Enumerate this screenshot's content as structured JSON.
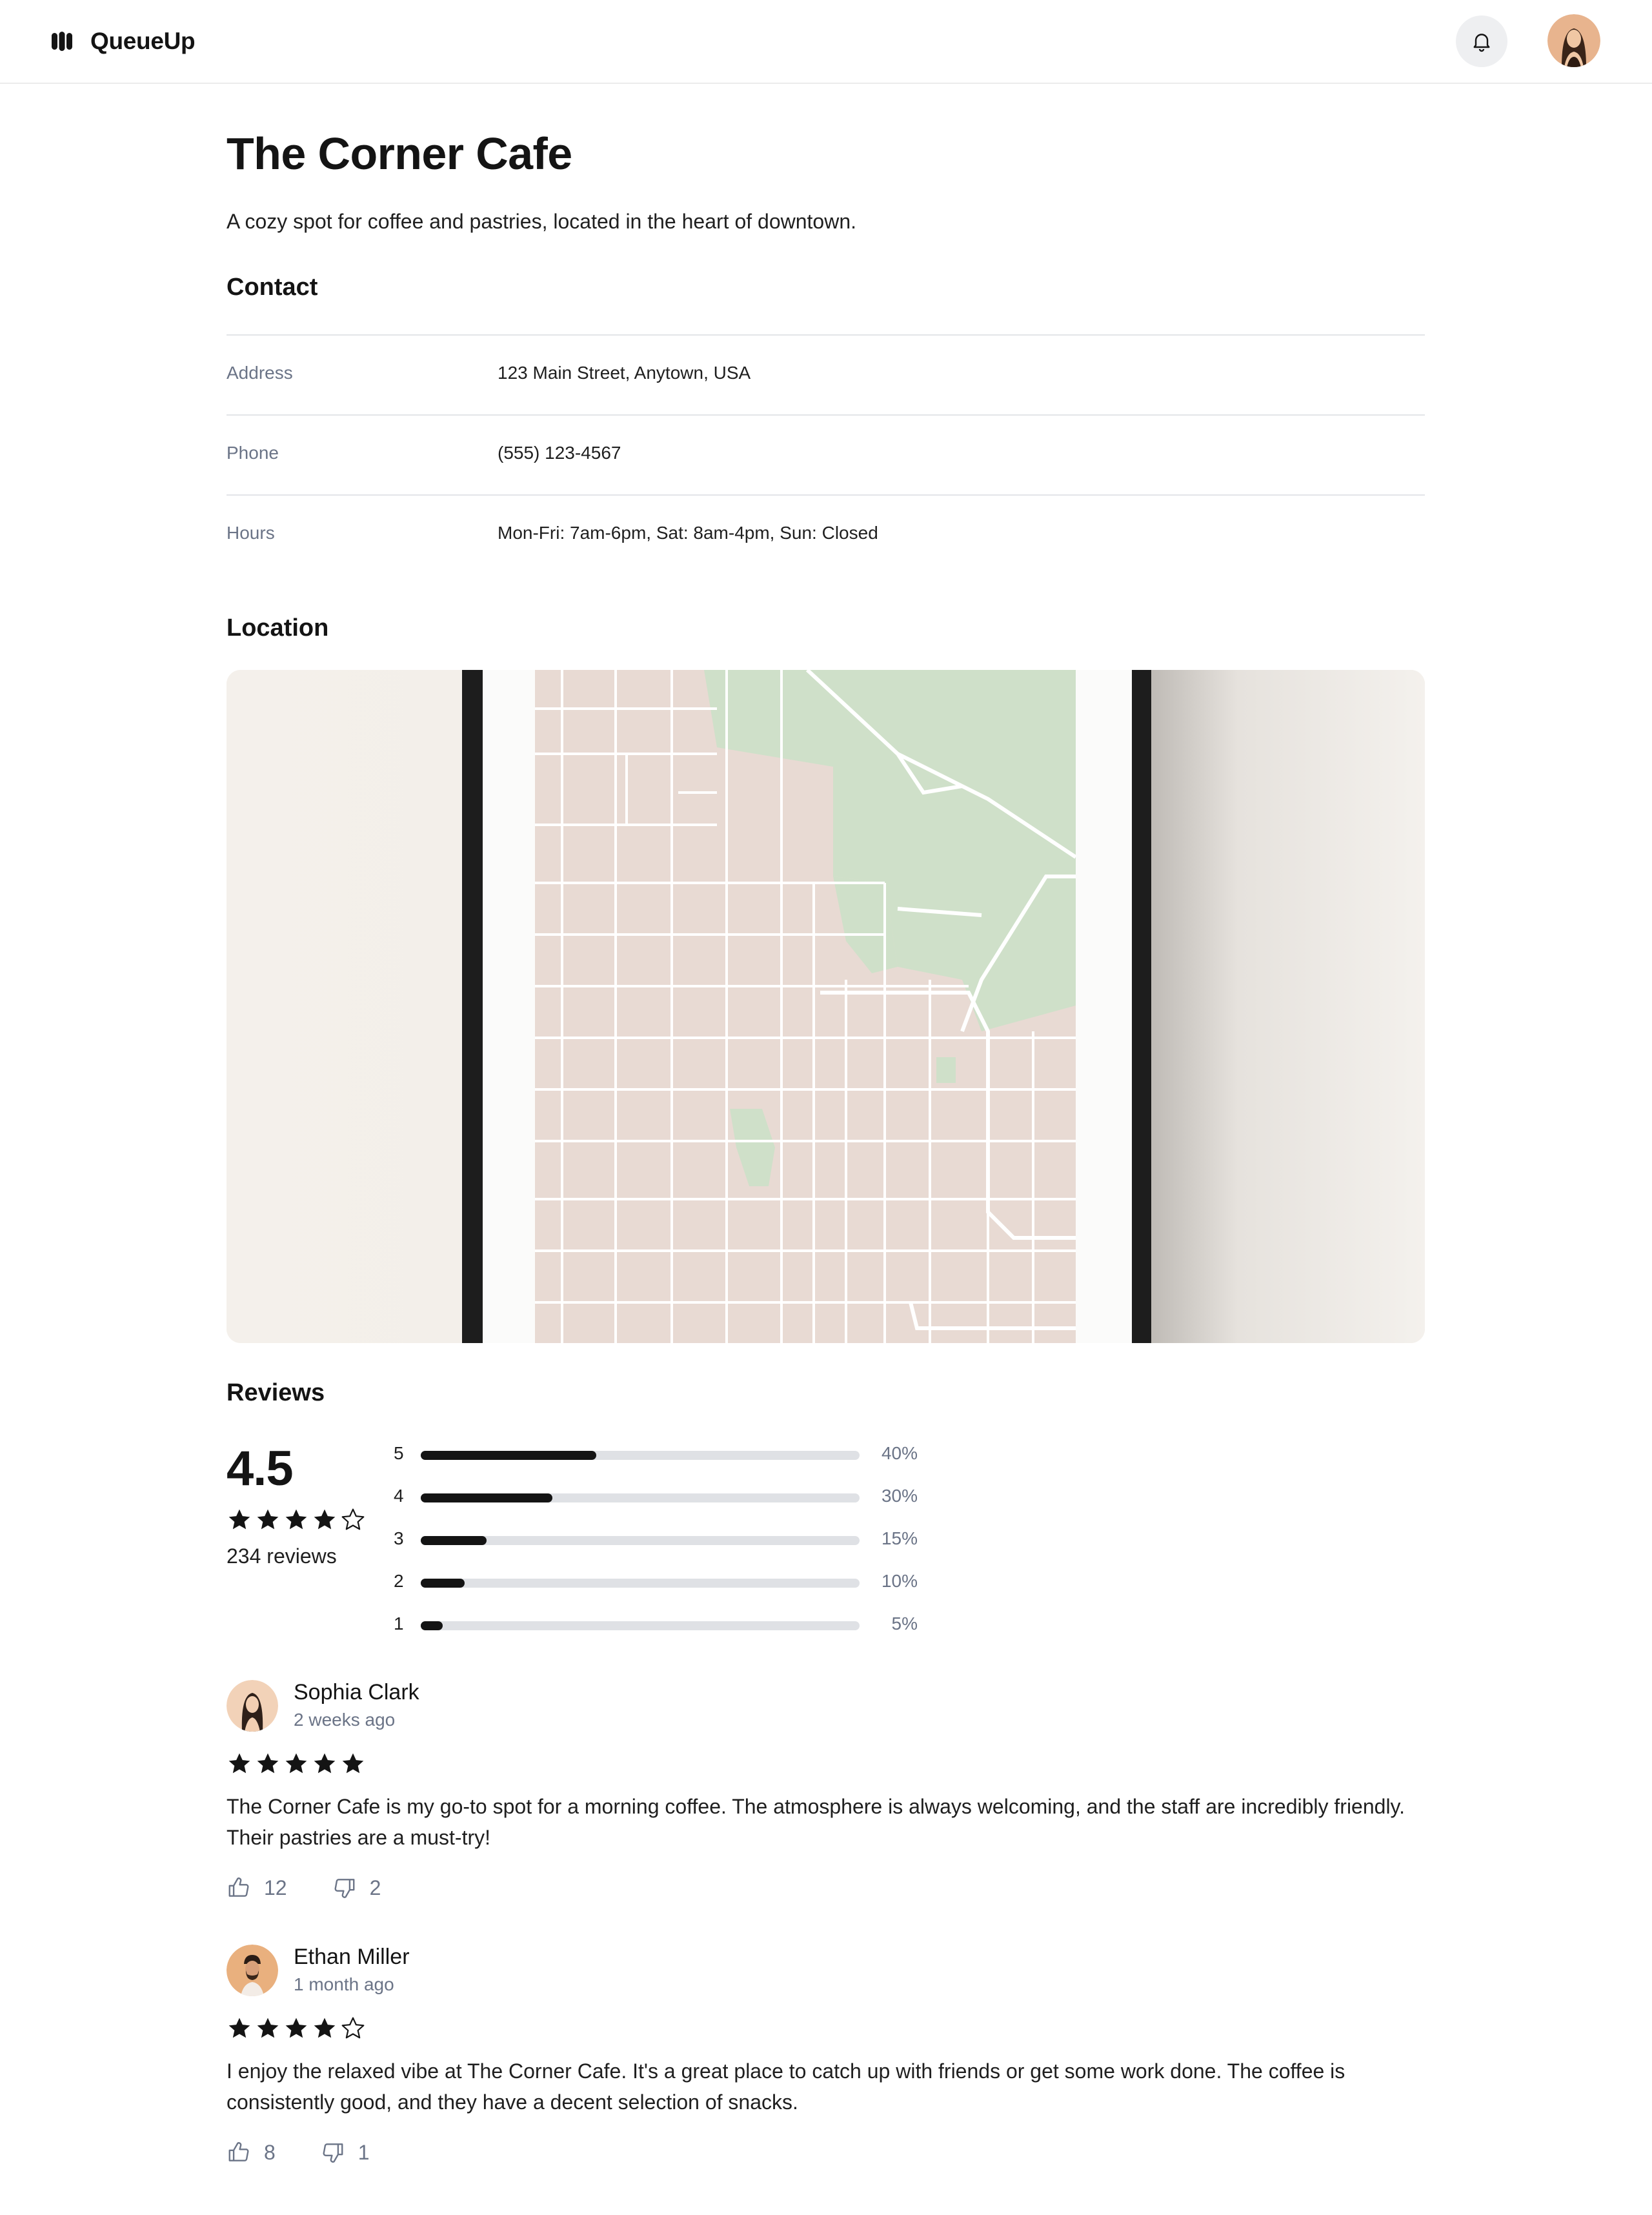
{
  "header": {
    "app_name": "QueueUp",
    "logo_icon": "queueup-logo-icon",
    "notification_icon": "bell-icon",
    "avatar": "user-avatar"
  },
  "place": {
    "name": "The Corner Cafe",
    "description": "A cozy spot for coffee and pastries, located in the heart of downtown."
  },
  "contact": {
    "heading": "Contact",
    "rows": [
      {
        "label": "Address",
        "value": "123 Main Street, Anytown, USA"
      },
      {
        "label": "Phone",
        "value": "(555) 123-4567"
      },
      {
        "label": "Hours",
        "value": "Mon-Fri: 7am-6pm, Sat: 8am-4pm, Sun: Closed"
      }
    ]
  },
  "location": {
    "heading": "Location",
    "map": "framed-street-map-image"
  },
  "reviews": {
    "heading": "Reviews",
    "average": "4.5",
    "average_stars": 4,
    "count_label": "234 reviews",
    "distribution": [
      {
        "stars": "5",
        "percent": 40,
        "label": "40%"
      },
      {
        "stars": "4",
        "percent": 30,
        "label": "30%"
      },
      {
        "stars": "3",
        "percent": 15,
        "label": "15%"
      },
      {
        "stars": "2",
        "percent": 10,
        "label": "10%"
      },
      {
        "stars": "1",
        "percent": 5,
        "label": "5%"
      }
    ],
    "items": [
      {
        "name": "Sophia Clark",
        "date": "2 weeks ago",
        "stars": 5,
        "text": "The Corner Cafe is my go-to spot for a morning coffee. The atmosphere is always welcoming, and the staff are incredibly friendly. Their pastries are a must-try!",
        "likes": "12",
        "dislikes": "2"
      },
      {
        "name": "Ethan Miller",
        "date": "1 month ago",
        "stars": 4,
        "text": "I enjoy the relaxed vibe at The Corner Cafe. It's a great place to catch up with friends or get some work done. The coffee is consistently good, and they have a decent selection of snacks.",
        "likes": "8",
        "dislikes": "1"
      }
    ]
  },
  "colors": {
    "text": "#141414",
    "muted": "#6b7487",
    "divider": "#e3e5e8",
    "bar_track": "#dfe1e5",
    "bar_fill": "#141414"
  }
}
